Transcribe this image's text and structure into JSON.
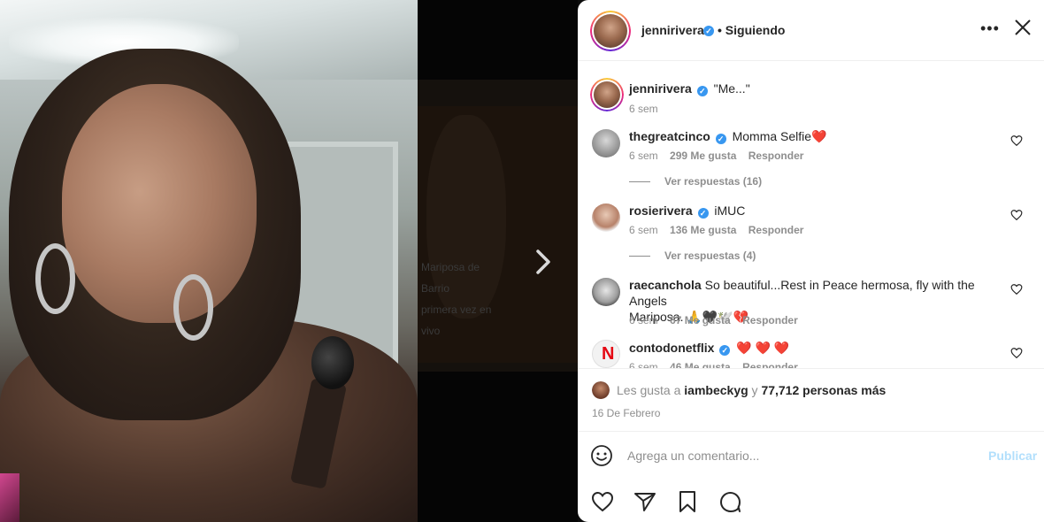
{
  "post": {
    "username": "jennirivera",
    "following_label": "• Siguiendo",
    "caption": "\"Me...\"",
    "caption_time": "6 sem"
  },
  "comments": [
    {
      "username": "thegreatcinco",
      "text": "Momma Selfie",
      "emoji": "❤️",
      "time": "6 sem",
      "likes": "299 Me gusta",
      "reply": "Responder",
      "view_replies": "Ver respuestas (16)",
      "verified": true
    },
    {
      "username": "rosierivera",
      "text": "iMUC",
      "emoji": "",
      "time": "6 sem",
      "likes": "136 Me gusta",
      "reply": "Responder",
      "view_replies": "Ver respuestas (4)",
      "verified": true
    },
    {
      "username": "raecanchola",
      "text": "So beautiful...Rest in Peace hermosa, fly with the Angels",
      "text2": "Mariposa. 🙏🖤🕊️💔",
      "time": "6 sem",
      "likes": "67 Me gusta",
      "reply": "Responder",
      "verified": false
    },
    {
      "username": "contodonetflix",
      "text": "❤️ ❤️ ❤️",
      "time": "6 sem",
      "likes": "46 Me gusta",
      "reply": "Responder",
      "verified": true
    }
  ],
  "likes": {
    "prefix": "Les gusta a ",
    "user": "iambeckyg",
    "connector": " y ",
    "count": "77,712 personas más"
  },
  "date": "16 De Febrero",
  "comment_box": {
    "placeholder": "Agrega un comentario...",
    "publish": "Publicar"
  },
  "preview_text": "Mariposa de\nBarrio\nprimera vez en\nvivo",
  "icons": {
    "more": "more-options-icon",
    "close": "close-icon",
    "next": "chevron-right-icon",
    "like": "heart-icon",
    "share": "paper-plane-icon",
    "save": "bookmark-icon",
    "comment": "speech-bubble-icon",
    "emoji": "smiley-icon",
    "verified": "verified-badge-icon"
  },
  "colors": {
    "verified": "#3897f0",
    "publish_disabled": "#b2dffc",
    "heart": "#ed4956"
  }
}
